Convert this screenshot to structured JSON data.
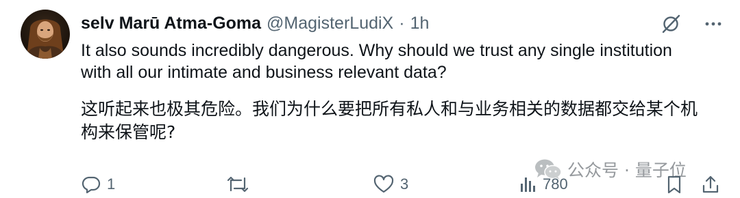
{
  "tweet": {
    "display_name": "selv Marū Atma-Goma",
    "handle": "@MagisterLudiX",
    "separator": "·",
    "time": "1h",
    "text_en": "It also sounds incredibly dangerous.  Why should we trust any single institution with all our intimate and business relevant data?",
    "text_cn": "这听起来也极其危险。我们为什么要把所有私人和与业务相关的数据都交给某个机构来保管呢?"
  },
  "actions": {
    "reply_count": "1",
    "repost_count": "",
    "like_count": "3",
    "views_count": "780"
  },
  "watermark": {
    "text": "公众号 · 量子位"
  },
  "icons": {
    "grok": "grok-icon",
    "more": "more-icon",
    "reply": "reply-icon",
    "repost": "repost-icon",
    "like": "like-icon",
    "views": "views-icon",
    "bookmark": "bookmark-icon",
    "share": "share-icon",
    "wechat": "wechat-icon"
  },
  "colors": {
    "text_primary": "#0f1419",
    "text_secondary": "#536471",
    "watermark": "#8a8f93",
    "background": "#ffffff"
  }
}
